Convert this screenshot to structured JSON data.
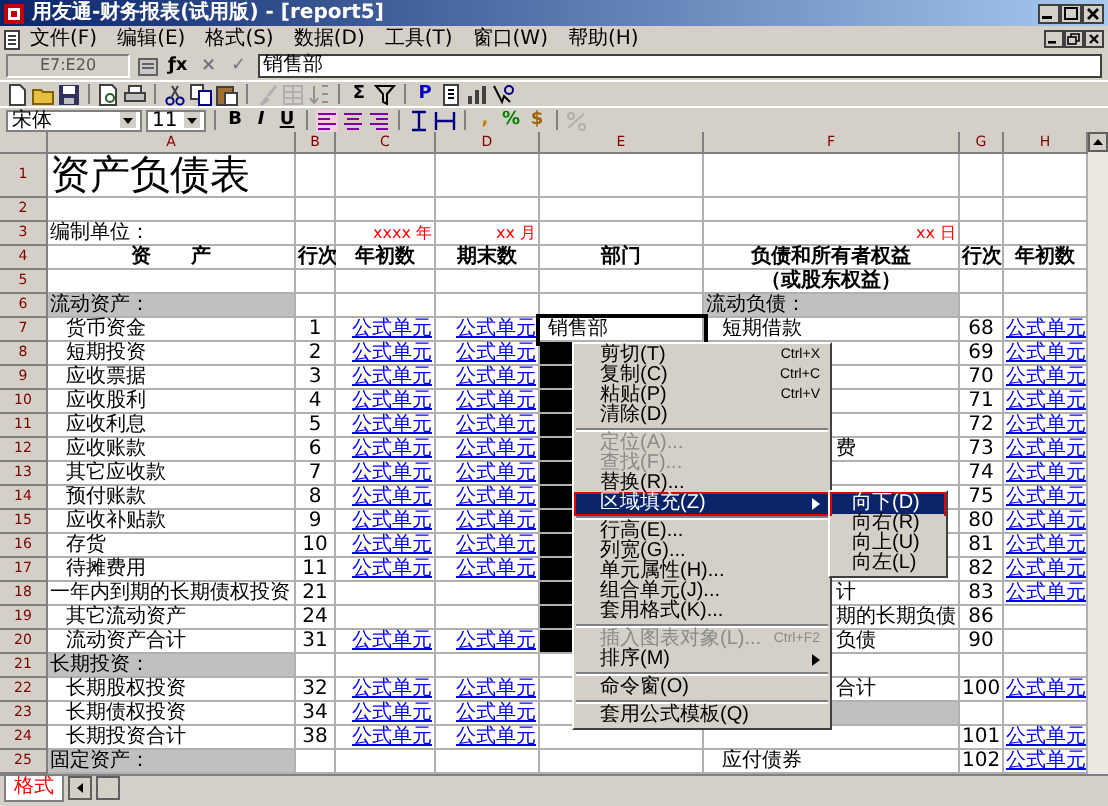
{
  "window": {
    "title": "用友通-财务报表(试用版) - [report5]"
  },
  "menu_bar": [
    "文件(F)",
    "编辑(E)",
    "格式(S)",
    "数据(D)",
    "工具(T)",
    "窗口(W)",
    "帮助(H)"
  ],
  "formula_bar": {
    "cell_ref": "E7:E20",
    "fx": "ƒx",
    "cancel": "×",
    "confirm": "✓",
    "value": "销售部"
  },
  "standard_toolbar": {
    "sum": "Σ",
    "p": "P"
  },
  "format_toolbar": {
    "font": "宋体",
    "size": "11",
    "styles": [
      "B",
      "I",
      "U"
    ],
    "number_formats": [
      ",",
      "%",
      "$"
    ]
  },
  "columns": [
    "A",
    "B",
    "C",
    "D",
    "E",
    "F",
    "G",
    "H"
  ],
  "rows": [
    {
      "number": "1",
      "left": {
        "kind": "title",
        "cells": {
          "A": "资产负债表"
        }
      },
      "dept": {
        "selected": false,
        "active": false
      },
      "right": {
        "kind": "blank"
      }
    },
    {
      "number": "2",
      "left": {
        "kind": "blank"
      },
      "dept": {
        "selected": false,
        "active": false
      },
      "right": {
        "kind": "blank"
      }
    },
    {
      "number": "3",
      "left": {
        "kind": "meta",
        "cells": {
          "A": "编制单位：",
          "C": "xxxx 年",
          "D": "xx 月"
        }
      },
      "dept": {
        "selected": false,
        "active": false
      },
      "right": {
        "kind": "meta",
        "cells": {
          "F": "xx 日"
        }
      }
    },
    {
      "number": "4",
      "left": {
        "kind": "header",
        "cells": {
          "A": "资　　产",
          "B": "行次",
          "C": "年初数",
          "D": "期末数"
        }
      },
      "dept": {
        "text": "部门",
        "selected": false,
        "active": false
      },
      "right": {
        "kind": "header",
        "cells": {
          "F": "负债和所有者权益",
          "G": "行次",
          "H": "年初数"
        }
      }
    },
    {
      "number": "5",
      "left": {
        "kind": "blank"
      },
      "dept": {
        "selected": false,
        "active": false
      },
      "right": {
        "kind": "header",
        "cells": {
          "F": "（或股东权益）"
        }
      }
    },
    {
      "number": "6",
      "left": {
        "kind": "section",
        "cells": {
          "A": "流动资产："
        }
      },
      "dept": {
        "selected": false,
        "active": false
      },
      "right": {
        "kind": "section",
        "cells": {
          "F": "流动负债："
        }
      }
    },
    {
      "number": "7",
      "left": {
        "kind": "item",
        "indented": true,
        "cells": {
          "A": "货币资金",
          "B": "1",
          "C": "公式单元",
          "D": "公式单元"
        }
      },
      "dept": {
        "text": "销售部",
        "selected": true,
        "active": true
      },
      "right": {
        "kind": "item",
        "cells": {
          "F": "短期借款",
          "G": "68",
          "H": "公式单元"
        }
      }
    },
    {
      "number": "8",
      "left": {
        "kind": "item",
        "indented": true,
        "cells": {
          "A": "短期投资",
          "B": "2",
          "C": "公式单元",
          "D": "公式单元"
        }
      },
      "dept": {
        "selected": true,
        "active": false
      },
      "right": {
        "kind": "covered",
        "cells": {
          "G": "69",
          "H": "公式单元"
        }
      }
    },
    {
      "number": "9",
      "left": {
        "kind": "item",
        "indented": true,
        "cells": {
          "A": "应收票据",
          "B": "3",
          "C": "公式单元",
          "D": "公式单元"
        }
      },
      "dept": {
        "selected": true,
        "active": false
      },
      "right": {
        "kind": "covered",
        "cells": {
          "G": "70",
          "H": "公式单元"
        }
      }
    },
    {
      "number": "10",
      "left": {
        "kind": "item",
        "indented": true,
        "cells": {
          "A": "应收股利",
          "B": "4",
          "C": "公式单元",
          "D": "公式单元"
        }
      },
      "dept": {
        "selected": true,
        "active": false
      },
      "right": {
        "kind": "covered",
        "cells": {
          "G": "71",
          "H": "公式单元"
        }
      }
    },
    {
      "number": "11",
      "left": {
        "kind": "item",
        "indented": true,
        "cells": {
          "A": "应收利息",
          "B": "5",
          "C": "公式单元",
          "D": "公式单元"
        }
      },
      "dept": {
        "selected": true,
        "active": false
      },
      "right": {
        "kind": "covered",
        "cells": {
          "G": "72",
          "H": "公式单元"
        }
      }
    },
    {
      "number": "12",
      "left": {
        "kind": "item",
        "indented": true,
        "cells": {
          "A": "应收账款",
          "B": "6",
          "C": "公式单元",
          "D": "公式单元"
        }
      },
      "dept": {
        "selected": true,
        "active": false
      },
      "right": {
        "kind": "covered",
        "cells": {
          "F": "费",
          "G": "73",
          "H": "公式单元"
        }
      }
    },
    {
      "number": "13",
      "left": {
        "kind": "item",
        "indented": true,
        "cells": {
          "A": "其它应收款",
          "B": "7",
          "C": "公式单元",
          "D": "公式单元"
        }
      },
      "dept": {
        "selected": true,
        "active": false
      },
      "right": {
        "kind": "covered",
        "cells": {
          "G": "74",
          "H": "公式单元"
        }
      }
    },
    {
      "number": "14",
      "left": {
        "kind": "item",
        "indented": true,
        "cells": {
          "A": "预付账款",
          "B": "8",
          "C": "公式单元",
          "D": "公式单元"
        }
      },
      "dept": {
        "selected": true,
        "active": false
      },
      "right": {
        "kind": "covered",
        "cells": {
          "G": "75",
          "H": "公式单元"
        }
      }
    },
    {
      "number": "15",
      "left": {
        "kind": "item",
        "indented": true,
        "cells": {
          "A": "应收补贴款",
          "B": "9",
          "C": "公式单元",
          "D": "公式单元"
        }
      },
      "dept": {
        "selected": true,
        "active": false
      },
      "right": {
        "kind": "covered",
        "cells": {
          "G": "80",
          "H": "公式单元"
        }
      }
    },
    {
      "number": "16",
      "left": {
        "kind": "item",
        "indented": true,
        "cells": {
          "A": "存货",
          "B": "10",
          "C": "公式单元",
          "D": "公式单元"
        }
      },
      "dept": {
        "selected": true,
        "active": false
      },
      "right": {
        "kind": "covered",
        "cells": {
          "G": "81",
          "H": "公式单元"
        }
      }
    },
    {
      "number": "17",
      "left": {
        "kind": "item",
        "indented": true,
        "cells": {
          "A": "待摊费用",
          "B": "11",
          "C": "公式单元",
          "D": "公式单元"
        }
      },
      "dept": {
        "selected": true,
        "active": false
      },
      "right": {
        "kind": "covered",
        "cells": {
          "G": "82",
          "H": "公式单元"
        }
      }
    },
    {
      "number": "18",
      "left": {
        "kind": "item",
        "indented": false,
        "cells": {
          "A": "一年内到期的长期债权投资",
          "B": "21"
        }
      },
      "dept": {
        "selected": true,
        "active": false
      },
      "right": {
        "kind": "covered",
        "cells": {
          "F": "计",
          "G": "83",
          "H": "公式单元"
        }
      }
    },
    {
      "number": "19",
      "left": {
        "kind": "item",
        "indented": true,
        "cells": {
          "A": "其它流动资产",
          "B": "24"
        }
      },
      "dept": {
        "selected": true,
        "active": false
      },
      "right": {
        "kind": "covered",
        "cells": {
          "F": "期的长期负债",
          "G": "86"
        }
      }
    },
    {
      "number": "20",
      "left": {
        "kind": "item",
        "indented": true,
        "cells": {
          "A": "流动资产合计",
          "B": "31",
          "C": "公式单元",
          "D": "公式单元"
        }
      },
      "dept": {
        "selected": true,
        "active": false
      },
      "right": {
        "kind": "covered",
        "cells": {
          "F": "负债",
          "G": "90"
        }
      }
    },
    {
      "number": "21",
      "left": {
        "kind": "section",
        "cells": {
          "A": "长期投资："
        }
      },
      "dept": {
        "selected": false,
        "active": false
      },
      "right": {
        "kind": "blank"
      }
    },
    {
      "number": "22",
      "left": {
        "kind": "item",
        "indented": true,
        "cells": {
          "A": "长期股权投资",
          "B": "32",
          "C": "公式单元",
          "D": "公式单元"
        }
      },
      "dept": {
        "selected": false,
        "active": false
      },
      "right": {
        "kind": "covered",
        "cells": {
          "F": "合计",
          "G": "100",
          "H": "公式单元"
        }
      }
    },
    {
      "number": "23",
      "left": {
        "kind": "item",
        "indented": true,
        "cells": {
          "A": "长期债权投资",
          "B": "34",
          "C": "公式单元",
          "D": "公式单元"
        }
      },
      "dept": {
        "selected": false,
        "active": false
      },
      "right": {
        "kind": "section"
      }
    },
    {
      "number": "24",
      "left": {
        "kind": "item",
        "indented": true,
        "cells": {
          "A": "长期投资合计",
          "B": "38",
          "C": "公式单元",
          "D": "公式单元"
        }
      },
      "dept": {
        "selected": false,
        "active": false
      },
      "right": {
        "kind": "covered",
        "cells": {
          "G": "101",
          "H": "公式单元"
        }
      }
    },
    {
      "number": "25",
      "left": {
        "kind": "section",
        "cells": {
          "A": "固定资产："
        }
      },
      "dept": {
        "selected": false,
        "active": false
      },
      "right": {
        "kind": "item",
        "cells": {
          "F": "应付债券",
          "G": "102",
          "H": "公式单元"
        }
      }
    }
  ],
  "context_menu": {
    "frame_selected": true,
    "items": [
      {
        "kind": "item",
        "label": "剪切(T)",
        "shortcut": "Ctrl+X",
        "disabled": false,
        "selected": false
      },
      {
        "kind": "item",
        "label": "复制(C)",
        "shortcut": "Ctrl+C",
        "disabled": false,
        "selected": false
      },
      {
        "kind": "item",
        "label": "粘贴(P)",
        "shortcut": "Ctrl+V",
        "disabled": false,
        "selected": false
      },
      {
        "kind": "item",
        "label": "清除(D)",
        "disabled": false,
        "selected": false
      },
      {
        "kind": "separator"
      },
      {
        "kind": "item",
        "label": "定位(A)...",
        "disabled": true,
        "selected": false
      },
      {
        "kind": "item",
        "label": "查找(F)...",
        "disabled": true,
        "selected": false
      },
      {
        "kind": "item",
        "label": "替换(R)...",
        "disabled": false,
        "selected": false
      },
      {
        "kind": "submenu",
        "label": "区域填充(Z)",
        "disabled": false,
        "selected": true
      },
      {
        "kind": "separator"
      },
      {
        "kind": "item",
        "label": "行高(E)...",
        "disabled": false,
        "selected": false
      },
      {
        "kind": "item",
        "label": "列宽(G)...",
        "disabled": false,
        "selected": false
      },
      {
        "kind": "item",
        "label": "单元属性(H)...",
        "disabled": false,
        "selected": false
      },
      {
        "kind": "item",
        "label": "组合单元(J)...",
        "disabled": false,
        "selected": false
      },
      {
        "kind": "item",
        "label": "套用格式(K)...",
        "disabled": false,
        "selected": false
      },
      {
        "kind": "separator"
      },
      {
        "kind": "item",
        "label": "插入图表对象(L)...",
        "shortcut": "Ctrl+F2",
        "disabled": true,
        "selected": false
      },
      {
        "kind": "submenu",
        "label": "排序(M)",
        "disabled": false,
        "selected": false
      },
      {
        "kind": "separator"
      },
      {
        "kind": "item",
        "label": "命令窗(O)",
        "disabled": false,
        "selected": false
      },
      {
        "kind": "separator"
      },
      {
        "kind": "item",
        "label": "套用公式模板(Q)",
        "disabled": false,
        "selected": false
      }
    ],
    "submenu": [
      {
        "label": "向下(D)",
        "selected": true
      },
      {
        "label": "向右(R)",
        "selected": false
      },
      {
        "label": "向上(U)",
        "selected": false
      },
      {
        "label": "向左(L)",
        "selected": false
      }
    ]
  },
  "sheet_tabs": [
    {
      "label": "格式",
      "selected": true
    }
  ]
}
